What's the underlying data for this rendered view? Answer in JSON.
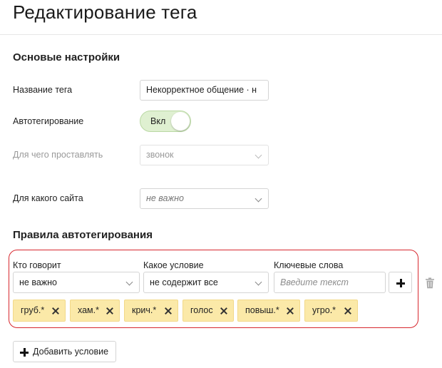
{
  "page": {
    "title": "Редактирование тега"
  },
  "basic": {
    "section_title": "Основые настройки",
    "tag_name_label": "Название тега",
    "tag_name_value": "Некорректное общение · н",
    "autotag_label": "Автотегирование",
    "autotag_toggle_label": "Вкл",
    "autotag_on": true,
    "apply_to_label": "Для чего проставлять",
    "apply_to_value": "звонок",
    "site_label": "Для какого сайта",
    "site_value": "не важно"
  },
  "rules": {
    "section_title": "Правила автотегирования",
    "col_speaker": "Кто говорит",
    "col_condition": "Какое условие",
    "col_keywords": "Ключевые слова",
    "speaker_value": "не важно",
    "condition_value": "не содержит все",
    "keyword_placeholder": "Введите текст",
    "chips": [
      "груб.*",
      "хам.*",
      "крич.*",
      "голос",
      "повыш.*",
      "угро.*"
    ],
    "add_condition_label": "Добавить условие"
  },
  "colors": {
    "highlight_border": "#d7282f",
    "chip_bg": "#fbe9a8",
    "toggle_bg": "#dff0d1"
  }
}
